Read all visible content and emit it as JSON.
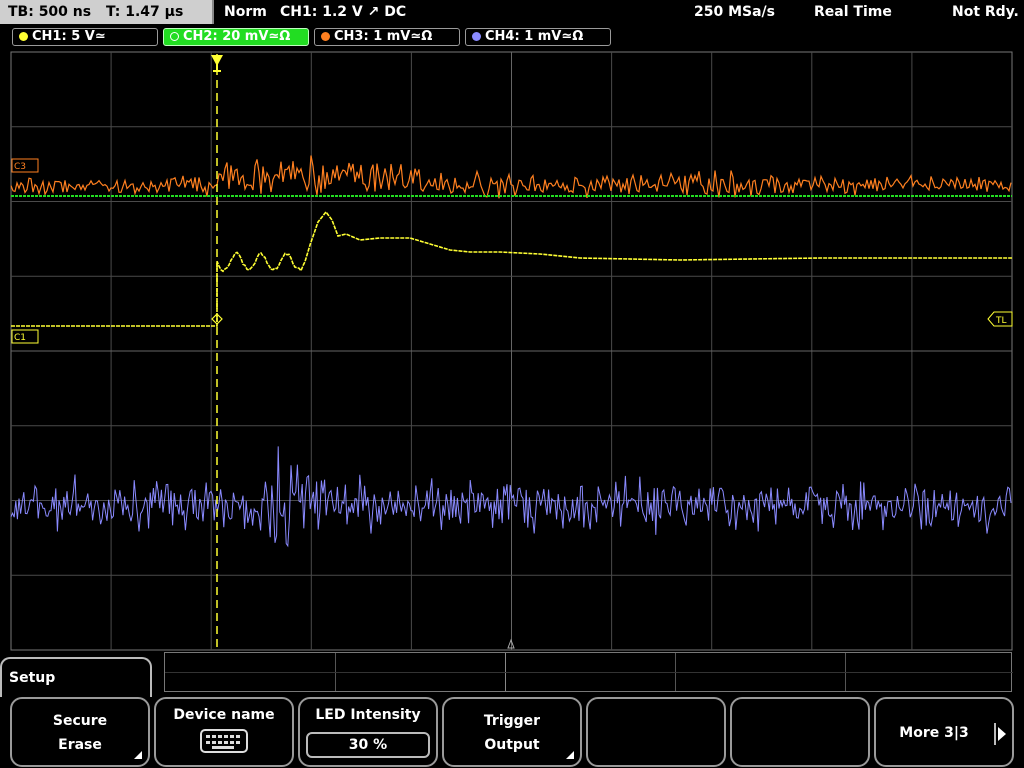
{
  "status": {
    "timebase": "TB: 500 ns",
    "trigger_time": "T: 1.47 µs",
    "mode": "Norm",
    "trigger_info": "CH1: 1.2 V ↗ DC",
    "sample_rate": "250 MSa/s",
    "acq_mode": "Real Time",
    "state": "Not Rdy."
  },
  "channels": [
    {
      "label": "CH1: 5 V≃",
      "color": "#ffff33"
    },
    {
      "label": "CH2: 20 mV≃Ω",
      "color": "#33dd33"
    },
    {
      "label": "CH3: 1 mV≃Ω",
      "color": "#ff8020"
    },
    {
      "label": "CH4: 1 mV≃Ω",
      "color": "#8888ff"
    }
  ],
  "markers": {
    "c3": "C3",
    "c1": "C1",
    "trigger_level": "TL"
  },
  "menu": {
    "title": "Setup",
    "keys": [
      {
        "line1": "Secure",
        "line2": "Erase"
      },
      {
        "line1": "Device name"
      },
      {
        "line1": "LED Intensity",
        "value": "30 %"
      },
      {
        "line1": "Trigger",
        "line2": "Output"
      },
      {
        "line1": ""
      },
      {
        "line1": ""
      },
      {
        "line1": "More 3|3"
      }
    ]
  },
  "colors": {
    "grid": "#4a4a4a",
    "ch1": "#ffff33",
    "ch2": "#22dd22",
    "ch3": "#ff8020",
    "ch4": "#8a8aff"
  }
}
